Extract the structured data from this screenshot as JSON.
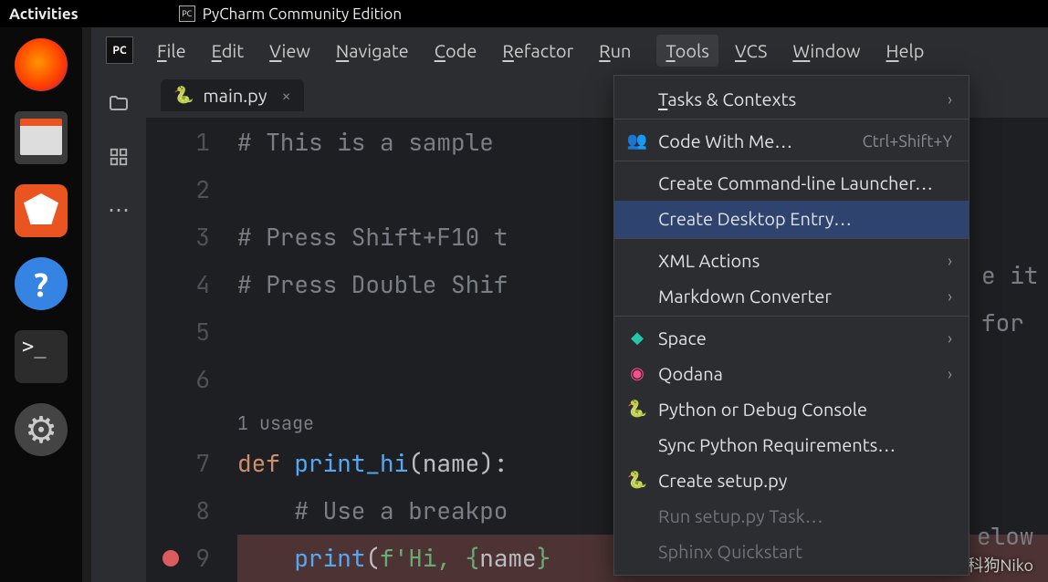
{
  "topbar": {
    "activities": "Activities",
    "app_title": "PyCharm Community Edition",
    "app_icon": "PC"
  },
  "dock": {
    "firefox": "firefox",
    "files": "files",
    "software": "software",
    "help_glyph": "?",
    "terminal_glyph": ">_",
    "settings_glyph": "⚙"
  },
  "menubar": {
    "logo": "PC",
    "items": [
      "File",
      "Edit",
      "View",
      "Navigate",
      "Code",
      "Refactor",
      "Run",
      "Tools",
      "VCS",
      "Window",
      "Help"
    ],
    "open_index": 7
  },
  "sidebar": {
    "folder": "📁",
    "structure": "⊞",
    "more": "⋯"
  },
  "tab": {
    "filename": "main.py",
    "close": "×"
  },
  "gutter": {
    "lines": [
      "1",
      "2",
      "3",
      "4",
      "5",
      "6",
      "",
      "7",
      "8",
      "9"
    ],
    "breakpoint_line": 9
  },
  "code": {
    "l1": "# This is a sample ",
    "l3": "# Press Shift+F10 t",
    "l4": "# Press Double Shif",
    "usage": "1 usage",
    "l7_def": "def ",
    "l7_fn": "print_hi",
    "l7_rest": "(name):",
    "l8": "    # Use a breakpo",
    "l9_pre": "    ",
    "l9_print": "print",
    "l9_open": "(",
    "l9_str1": "f'Hi, ",
    "l9_brace_open": "{",
    "l9_name": "name",
    "l9_brace_close": "}"
  },
  "code_peek": {
    "p3_tail": "e it ",
    "p4_tail": "for ",
    "p8_tail": "elow "
  },
  "dropdown": {
    "items": [
      {
        "label": "Tasks & Contexts",
        "submenu": true,
        "underline": 0,
        "sep_after": true
      },
      {
        "label": "Code With Me…",
        "icon": "👥",
        "shortcut": "Ctrl+Shift+Y",
        "sep_after": true
      },
      {
        "label": "Create Command-line Launcher…"
      },
      {
        "label": "Create Desktop Entry…",
        "highlight": true,
        "sep_after": true
      },
      {
        "label": "XML Actions",
        "submenu": true
      },
      {
        "label": "Markdown Converter",
        "submenu": true,
        "sep_after": true
      },
      {
        "label": "Space",
        "icon": "◆",
        "icon_color": "#21c7a8",
        "submenu": true
      },
      {
        "label": "Qodana",
        "icon": "◉",
        "icon_color": "#ff4d8d",
        "submenu": true
      },
      {
        "label": "Python or Debug Console",
        "icon": "🐍"
      },
      {
        "label": "Sync Python Requirements…"
      },
      {
        "label": "Create setup.py",
        "icon": "🐍"
      },
      {
        "label": "Run setup.py Task…",
        "disabled": true
      },
      {
        "label": "Sphinx Quickstart",
        "disabled": true
      }
    ]
  },
  "watermark": "CSDN @工科狗Niko"
}
